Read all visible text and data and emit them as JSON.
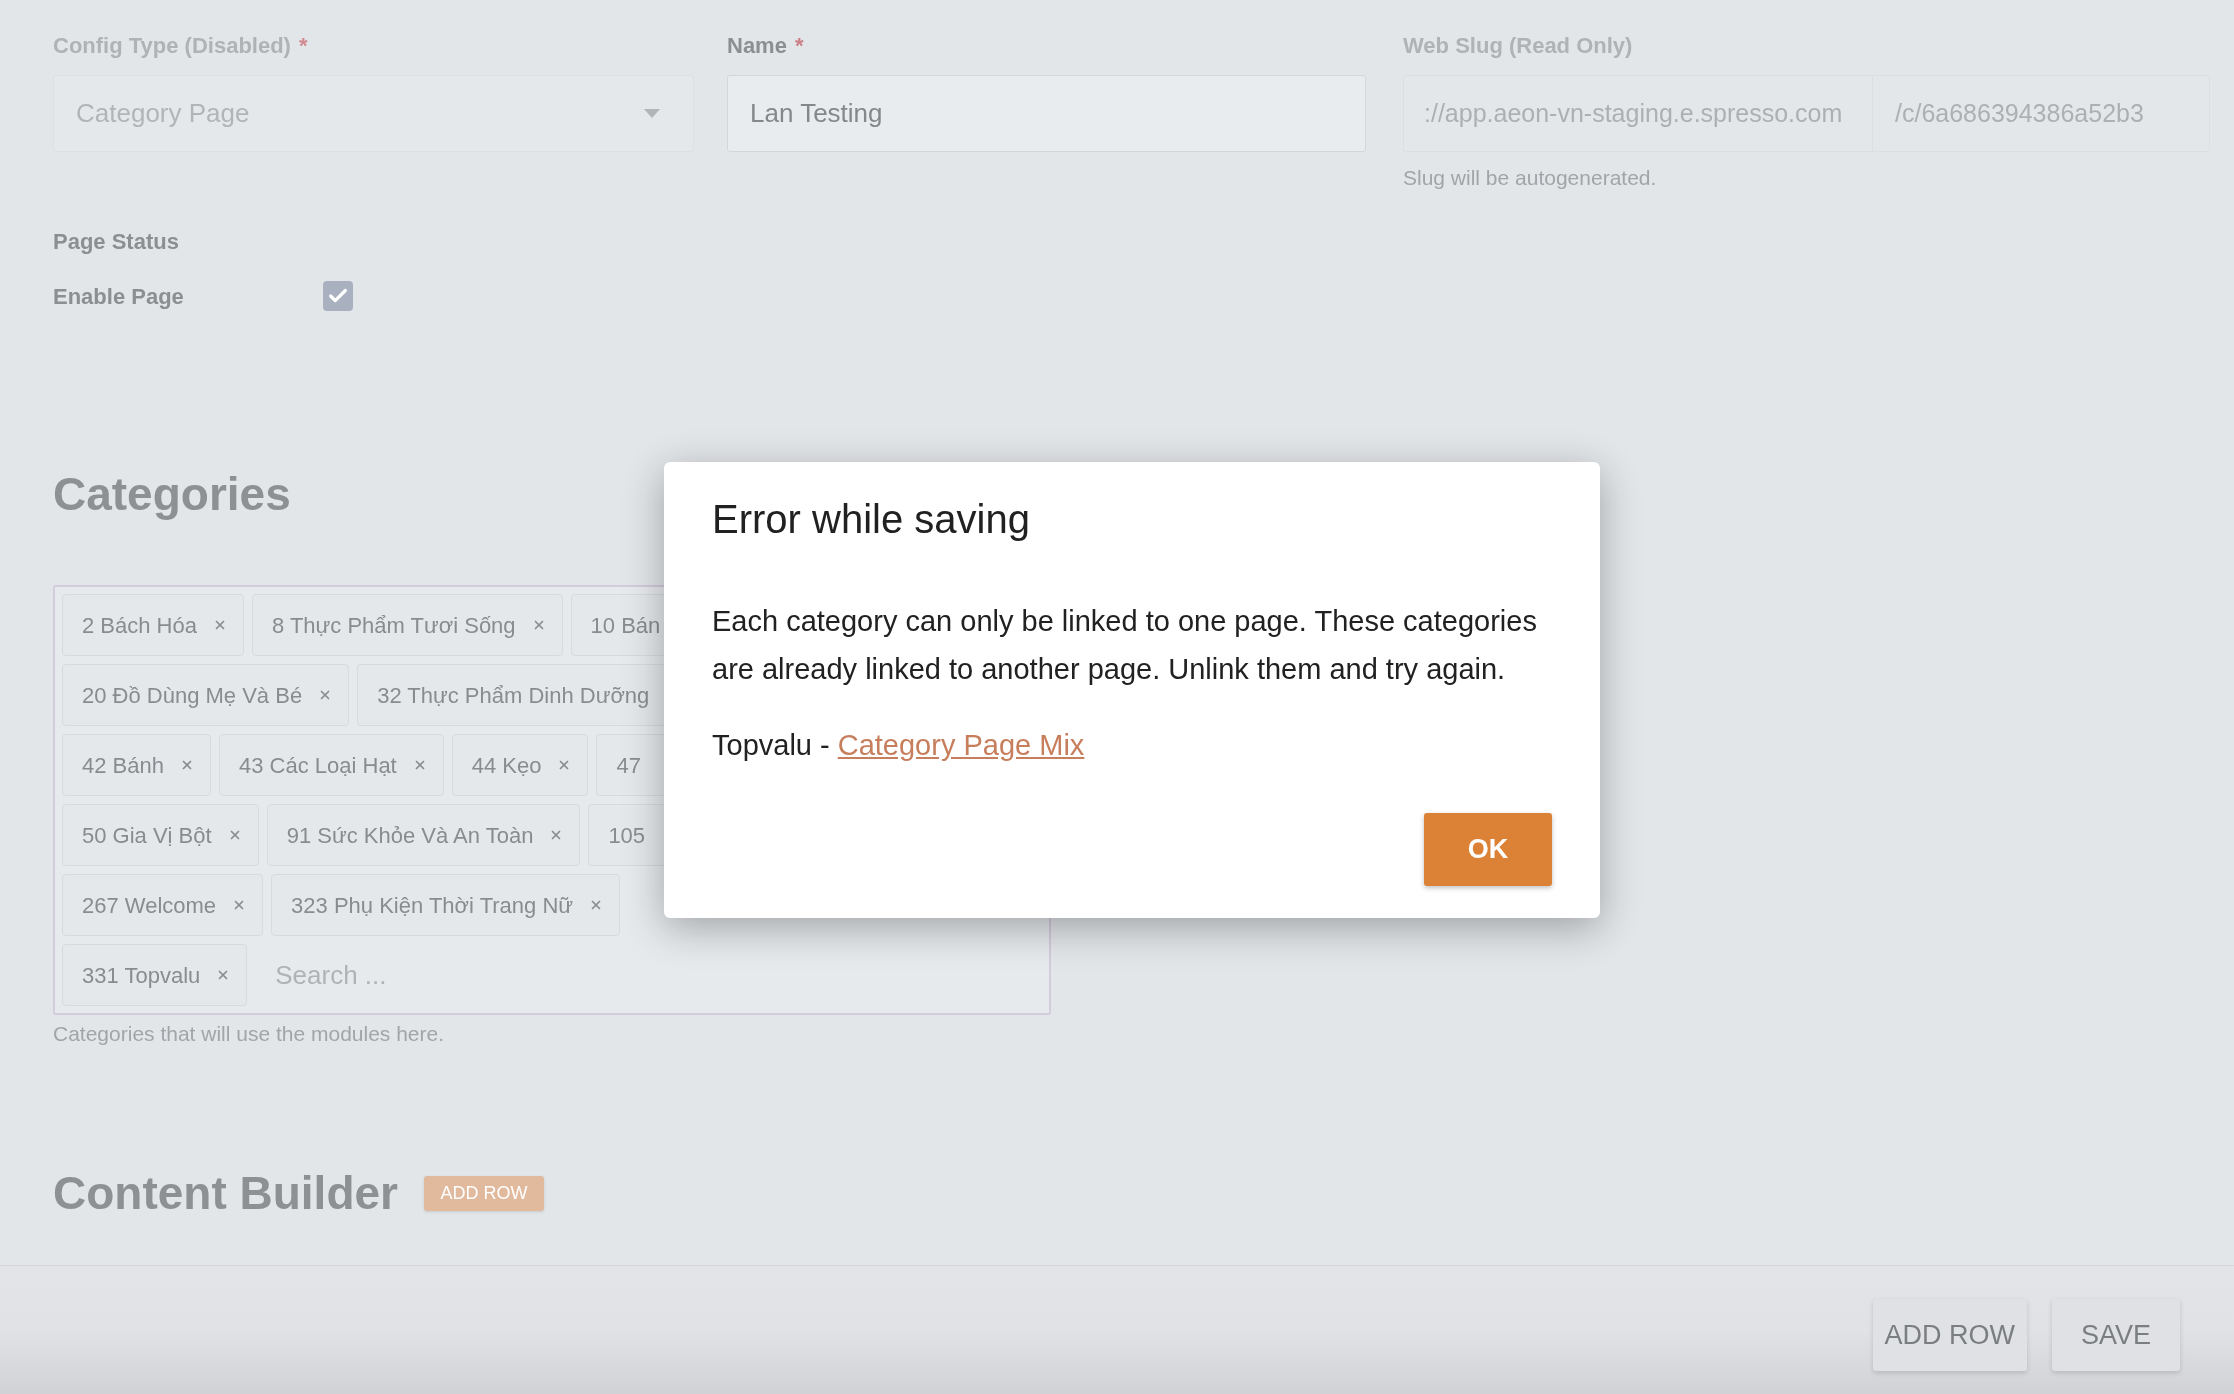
{
  "form": {
    "config_type": {
      "label": "Config Type (Disabled)",
      "required_mark": "*",
      "value": "Category Page",
      "disabled": true
    },
    "name": {
      "label": "Name",
      "required_mark": "*",
      "value": "Lan Testing"
    },
    "web_slug": {
      "label": "Web Slug (Read Only)",
      "base": "://app.aeon-vn-staging.e.spresso.com",
      "path": "/c/6a686394386a52b3",
      "hint": "Slug will be autogenerated."
    }
  },
  "page_status": {
    "title": "Page Status",
    "label": "Enable Page",
    "checked": true
  },
  "categories": {
    "title": "Categories",
    "rows": [
      {
        "tags": [
          "2 Bách Hóa",
          "8 Thực Phẩm Tươi Sống"
        ],
        "cut_tag": "10 Bán"
      },
      {
        "tags": [
          "20 Đồ Dùng Mẹ Và Bé"
        ],
        "cut_tag": "32 Thực Phẩm Dinh Dưỡng"
      },
      {
        "tags": [
          "42 Bánh",
          "43 Các Loại Hạt",
          "44 Kẹo"
        ],
        "cut_tag": "47"
      },
      {
        "tags": [
          "50 Gia Vị Bột",
          "91 Sức Khỏe Và An Toàn"
        ],
        "cut_tag": "105"
      },
      {
        "tags": [
          "267 Welcome",
          "323 Phụ Kiện Thời Trang Nữ"
        ]
      },
      {
        "tags": [
          "331 Topvalu"
        ]
      }
    ],
    "search": {
      "placeholder": "Search ..."
    },
    "hint": "Categories that will use the modules here."
  },
  "content_builder": {
    "title": "Content Builder",
    "add_row_label": "ADD ROW"
  },
  "footer": {
    "buttons": [
      "ADD ROW",
      "SAVE"
    ]
  },
  "dialog": {
    "title": "Error while saving",
    "message": "Each category can only be linked to one page. These categories are already linked to another page. Unlink them and try again.",
    "page_owner": "Topvalu -",
    "page_link": "Category Page Mix",
    "ok_label": "OK"
  }
}
